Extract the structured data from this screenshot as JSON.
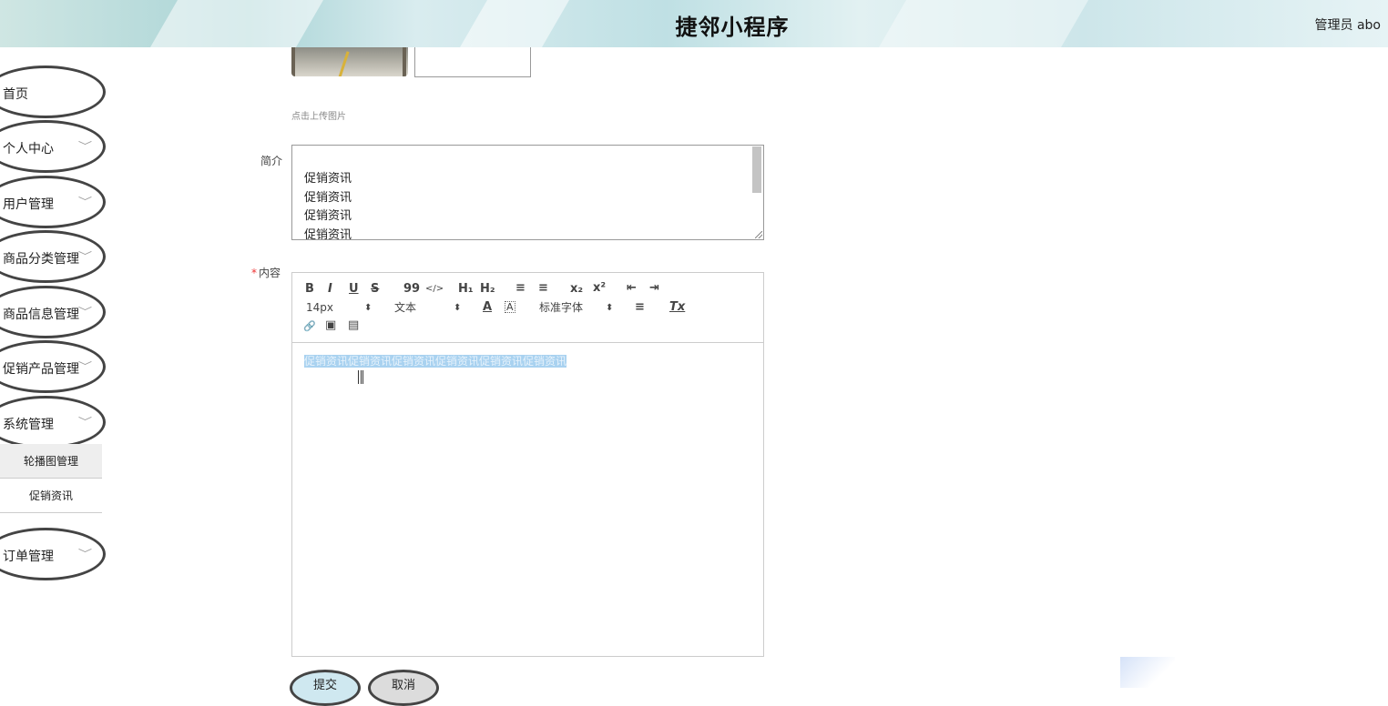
{
  "header": {
    "title": "捷邻小程序",
    "user": "管理员 abo"
  },
  "sidebar": {
    "items": [
      {
        "label": "首页",
        "has_chevron": false
      },
      {
        "label": "个人中心",
        "has_chevron": true
      },
      {
        "label": "用户管理",
        "has_chevron": true
      },
      {
        "label": "商品分类管理",
        "has_chevron": true
      },
      {
        "label": "商品信息管理",
        "has_chevron": true
      },
      {
        "label": "促销产品管理",
        "has_chevron": true
      },
      {
        "label": "系统管理",
        "has_chevron": true,
        "expanded": true
      },
      {
        "label": "订单管理",
        "has_chevron": true
      }
    ],
    "submenu": [
      {
        "label": "轮播图管理",
        "active": true
      },
      {
        "label": "促销资讯",
        "active": false
      }
    ],
    "chevron_glyph": "﹀"
  },
  "form": {
    "upload_hint": "点击上传图片",
    "intro_label": "简介",
    "intro_lines": [
      "促销资讯",
      "促销资讯",
      "促销资讯",
      "促销资讯"
    ],
    "content_label": "内容",
    "content_required": "*",
    "content_text": "促销资讯促销资讯促销资讯促销资讯促销资讯促销资讯"
  },
  "toolbar": {
    "bold": "B",
    "italic": "I",
    "underline": "U",
    "strike": "S",
    "blockquote": "99",
    "code": "</>",
    "h1": "H₁",
    "h2": "H₂",
    "ordered_list": "≡",
    "bullet_list": "≡",
    "subscript": "x₂",
    "superscript": "x²",
    "outdent": "⇤",
    "indent": "⇥",
    "size_value": "14px",
    "header_value": "文本",
    "font_value": "标准字体",
    "select_arrow": "⬍",
    "color": "A",
    "background": "A",
    "align": "≡",
    "clean": "Tx",
    "link": "🔗",
    "image": "▣",
    "video": "▤"
  },
  "actions": {
    "submit": "提交",
    "cancel": "取消"
  },
  "colors": {
    "selection": "#a9d2f0",
    "required": "#e33333",
    "submit_bg": "#cfe8f0",
    "cancel_bg": "#dcdcdc"
  }
}
